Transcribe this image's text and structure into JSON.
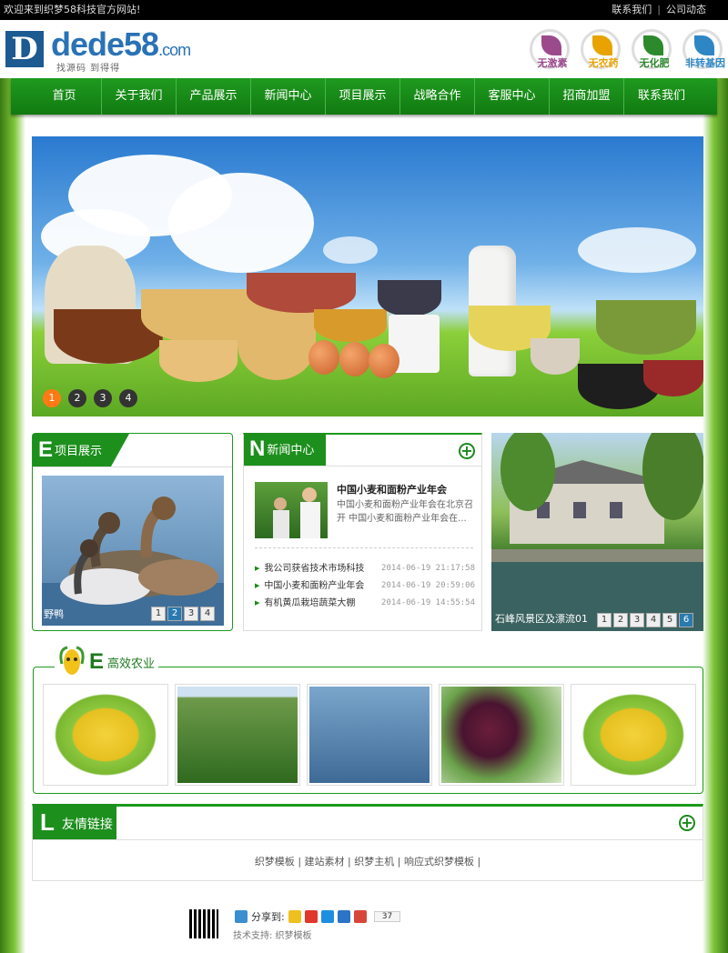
{
  "topbar": {
    "welcome": "欢迎来到织梦58科技官方网站!",
    "links": [
      "联系我们",
      "公司动态"
    ],
    "sep": "|"
  },
  "logo": {
    "mark": "D",
    "brand": "dede58",
    "domain": ".com",
    "slogan": "找源码 到得得"
  },
  "badges": [
    {
      "label": "无激素",
      "color": "#9b4b8c"
    },
    {
      "label": "无农药",
      "color": "#e8a300"
    },
    {
      "label": "无化肥",
      "color": "#2c8a2c"
    },
    {
      "label": "非转基因",
      "color": "#2f86c4"
    }
  ],
  "nav": [
    "首页",
    "关于我们",
    "产品展示",
    "新闻中心",
    "项目展示",
    "战略合作",
    "客服中心",
    "招商加盟",
    "联系我们"
  ],
  "banner": {
    "pages": [
      "1",
      "2",
      "3",
      "4"
    ],
    "active": 0
  },
  "project": {
    "letter": "E",
    "title": "项目展示",
    "caption": "野鸭",
    "pages": [
      "1",
      "2",
      "3",
      "4"
    ],
    "active": 1
  },
  "news": {
    "letter": "N",
    "title": "新闻中心",
    "plus": "+",
    "headline": "中国小麦和面粉产业年会",
    "summary": "中国小麦和面粉产业年会在北京召开 中国小麦和面粉产业年会在...",
    "items": [
      {
        "title": "我公司获省技术市场科技",
        "date": "2014-06-19 21:17:58"
      },
      {
        "title": "中国小麦和面粉产业年会",
        "date": "2014-06-19 20:59:06"
      },
      {
        "title": "有机黄瓜栽培蔬菜大棚",
        "date": "2014-06-19 14:55:54"
      }
    ]
  },
  "scenic": {
    "caption": "石峰风景区及漂流01",
    "pages": [
      "1",
      "2",
      "3",
      "4",
      "5",
      "6"
    ],
    "active": 5
  },
  "efficient": {
    "letter": "E",
    "title": "高效农业"
  },
  "friendlinks": {
    "letter": "L",
    "title": "友情链接",
    "plus": "+",
    "items": [
      "织梦模板",
      "建站素材",
      "织梦主机",
      "响应式织梦模板"
    ],
    "sep": "|"
  },
  "footer": {
    "share_label": "分享到:",
    "count": "37",
    "tech": "技术支持: 织梦模板"
  }
}
